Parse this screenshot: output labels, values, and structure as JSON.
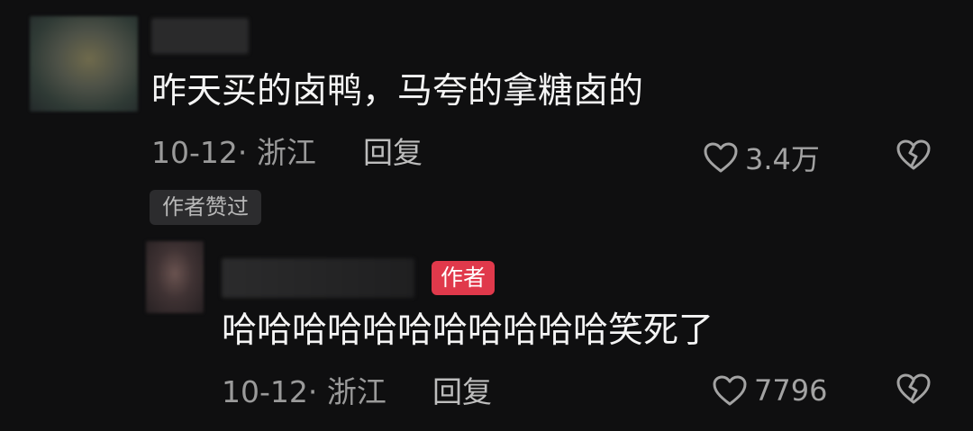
{
  "comment": {
    "text": "昨天买的卤鸭，马夸的拿糖卤的",
    "date_location": "10-12· 浙江",
    "reply_label": "回复",
    "like_count": "3.4万",
    "author_liked_badge": "作者赞过"
  },
  "reply": {
    "author_badge": "作者",
    "text": "哈哈哈哈哈哈哈哈哈哈哈笑死了",
    "date_location": "10-12· 浙江",
    "reply_label": "回复",
    "like_count": "7796"
  },
  "icons": {
    "like": "heart-outline-icon",
    "dislike": "broken-heart-icon"
  },
  "colors": {
    "background": "#0f0f10",
    "author_badge": "#e0394b"
  }
}
